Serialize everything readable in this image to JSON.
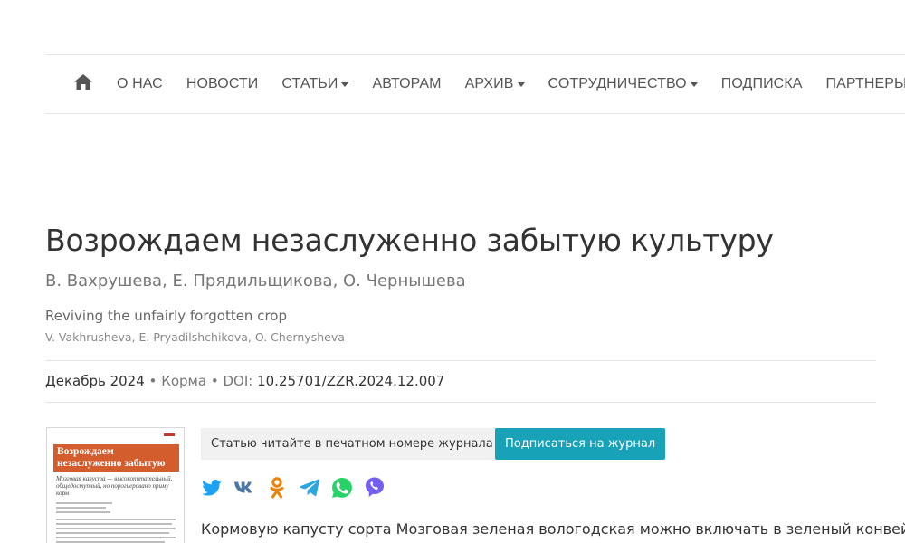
{
  "nav": {
    "items": [
      {
        "label": "О НАС",
        "dropdown": false
      },
      {
        "label": "НОВОСТИ",
        "dropdown": false
      },
      {
        "label": "СТАТЬИ",
        "dropdown": true
      },
      {
        "label": "АВТОРАМ",
        "dropdown": false
      },
      {
        "label": "АРХИВ",
        "dropdown": true
      },
      {
        "label": "СОТРУДНИЧЕСТВО",
        "dropdown": true
      },
      {
        "label": "ПОДПИСКА",
        "dropdown": false
      },
      {
        "label": "ПАРТНЕРЫ",
        "dropdown": false
      }
    ],
    "home_icon": "home-icon"
  },
  "article": {
    "title": "Возрождаем незаслуженно забытую культуру",
    "authors_ru": "В. Вахрушева, Е. Прядильщикова, О. Чернышева",
    "title_en": "Reviving the unfairly forgotten crop",
    "authors_en": "V. Vakhrusheva, E. Pryadilshchikova, O. Chernysheva",
    "date": "Декабрь 2024",
    "separator": "•",
    "category": "Корма",
    "doi_label": "DOI:",
    "doi": "10.25701/ZZR.2024.12.007",
    "lead": "Кормовую капусту сорта Мозговая зеленая вологодская можно включать в зеленый конвейер."
  },
  "cover": {
    "title": "Возрождаем незаслуженно забытую культуру",
    "subtitle": "Мозговая капуста — высокопитательный, общедоступный, но порогиеровано приму корм"
  },
  "actions": {
    "print_label": "Статью читайте в печатном номере журнала",
    "subscribe_label": "Подписаться на журнал"
  },
  "share": {
    "icons": [
      "twitter-icon",
      "vk-icon",
      "odnoklassniki-icon",
      "telegram-icon",
      "whatsapp-icon",
      "viber-icon"
    ]
  },
  "colors": {
    "accent": "#17a2b8",
    "twitter": "#1da1f2",
    "vk": "#4a76a8",
    "odnoklassniki": "#ee8208",
    "telegram": "#2ca5e0",
    "whatsapp": "#25d366",
    "viber": "#7360f2",
    "cover_band": "#d45d2e"
  }
}
